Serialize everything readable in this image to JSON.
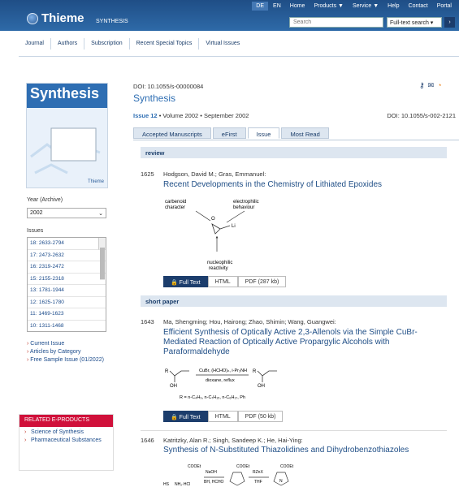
{
  "topnav": {
    "items": [
      "DE",
      "EN",
      "Home",
      "Products ▼",
      "Service ▼",
      "Help",
      "Contact",
      "Portal"
    ]
  },
  "header": {
    "logo": "Thieme",
    "journal": "SYNTHESIS",
    "search_placeholder": "Search",
    "search_type": "Full-text search"
  },
  "subnav": {
    "items": [
      "Journal",
      "Authors",
      "Subscription",
      "Recent Special Topics",
      "Virtual Issues"
    ]
  },
  "sidebar": {
    "cover_title": "Synthesis",
    "cover_brand": "Thieme",
    "year_label": "Year (Archive)",
    "year_value": "2002",
    "issues_label": "Issues",
    "issues": [
      "18: 2633-2794",
      "17: 2473-2632",
      "16: 2319-2472",
      "15: 2155-2318",
      "13: 1781-1944",
      "12: 1625-1780",
      "11: 1469-1623",
      "10: 1311-1468"
    ],
    "links": [
      "Current Issue",
      "Articles by Category",
      "Free Sample Issue (01/2022)"
    ],
    "related_title": "RELATED E-PRODUCTS",
    "related": [
      "Science of Synthesis",
      "Pharmaceutical Substances"
    ]
  },
  "main": {
    "doi": "DOI: 10.1055/s-00000084",
    "title": "Synthesis",
    "issue_prefix": "Issue 12",
    "issue_rest": " • Volume 2002 • September 2002",
    "issue_doi": "DOI: 10.1055/s-002-2121",
    "tabs": [
      "Accepted Manuscripts",
      "eFirst",
      "Issue",
      "Most Read"
    ],
    "sections": [
      "review",
      "short paper"
    ],
    "articles": [
      {
        "page": "1625",
        "authors": "Hodgson, David M.; Gras, Emmanuel:",
        "title": "Recent Developments in the Chemistry of Lithiated Epoxides",
        "pdf": "PDF (287 kb)",
        "labels": [
          "carbenoid",
          "character",
          "electrophilic",
          "behaviour",
          "nucleophilic",
          "reactivity",
          "Li",
          "O"
        ]
      },
      {
        "page": "1643",
        "authors": "Ma, Shengming; Hou, Hairong; Zhao, Shimin; Wang, Guangwei:",
        "title": "Efficient Synthesis of Optically Active 2,3-Allenols via the Simple CuBr-Mediated Reaction of Optically Active Propargylic Alcohols with Paraformaldehyde",
        "pdf": "PDF (50 kb)",
        "labels": [
          "R",
          "OH",
          "CuBr, (HCHO)ₙ, i-Pr₂NH",
          "dioxane, reflux",
          "R = n-C₄H₉, n-C₇H₁₅, n-C₆H₁₇, Ph"
        ]
      },
      {
        "page": "1646",
        "authors": "Katritzky, Alan R.; Singh, Sandeep K.; He, Hai-Ying:",
        "title": "Synthesis of N-Substituted Thiazolidines and Dihydrobenzothiazoles",
        "labels": [
          "COOEt",
          "NaOH",
          "RZnX",
          "HS",
          "NH₂·HCl",
          "BH, HCHO",
          "THF",
          "N"
        ]
      }
    ],
    "btn_fulltext": "Full Text",
    "btn_html": "HTML"
  }
}
